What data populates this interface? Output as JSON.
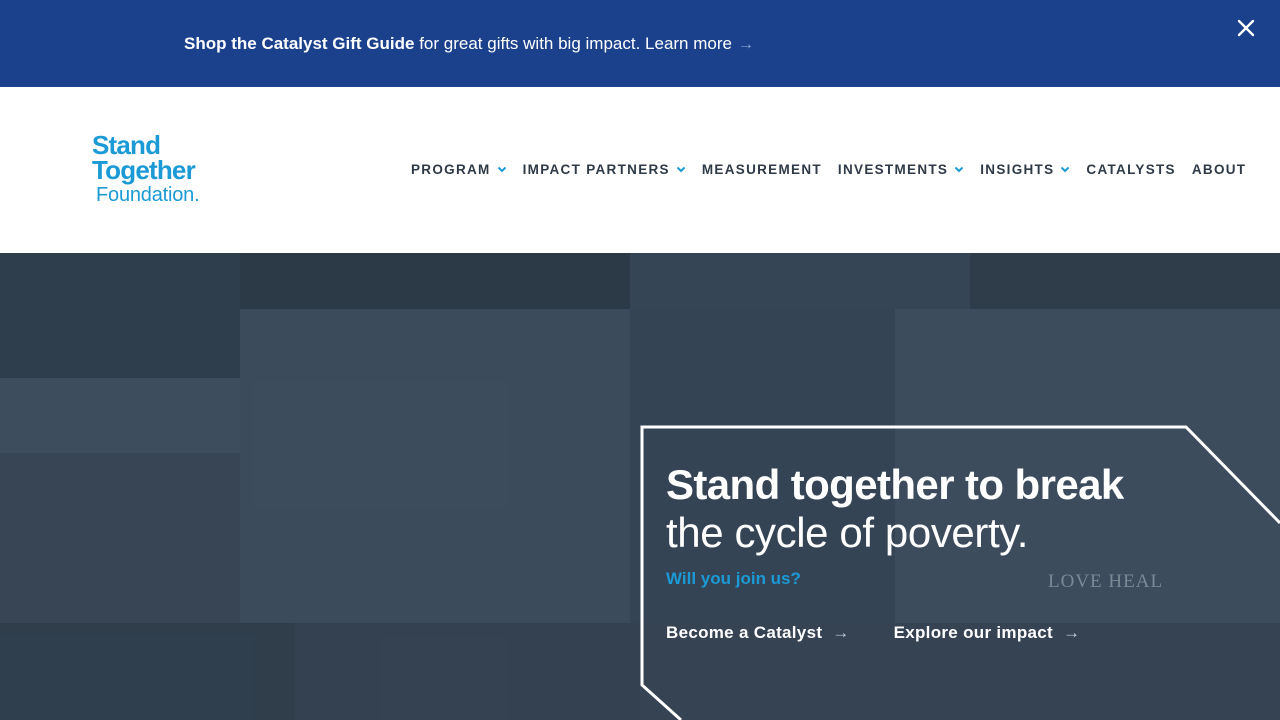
{
  "banner": {
    "bold_text": "Shop the Catalyst Gift Guide",
    "text": "for great gifts with big impact.",
    "link_label": "Learn more",
    "arrow": "→",
    "close_icon": "close-icon"
  },
  "logo": {
    "line1": "Stand",
    "line2": "Together",
    "line3": "Foundation."
  },
  "nav": {
    "items": [
      {
        "label": "PROGRAM",
        "has_dropdown": true
      },
      {
        "label": "IMPACT PARTNERS",
        "has_dropdown": true
      },
      {
        "label": "MEASUREMENT",
        "has_dropdown": false
      },
      {
        "label": "INVESTMENTS",
        "has_dropdown": true
      },
      {
        "label": "INSIGHTS",
        "has_dropdown": true
      },
      {
        "label": "CATALYSTS",
        "has_dropdown": false
      },
      {
        "label": "ABOUT",
        "has_dropdown": false
      }
    ]
  },
  "hero": {
    "headline_bold": "Stand together to break",
    "headline_light": "the cycle of poverty.",
    "subhead": "Will you join us?",
    "cta_primary": "Become a Catalyst",
    "cta_secondary": "Explore our impact",
    "arrow": "→",
    "background_sign_text": "LOVE HEAL"
  },
  "colors": {
    "banner_bg": "#1b418c",
    "brand_blue": "#1b9ad6",
    "nav_text": "#2f3a48",
    "hero_tint": "#3b4a5a"
  }
}
